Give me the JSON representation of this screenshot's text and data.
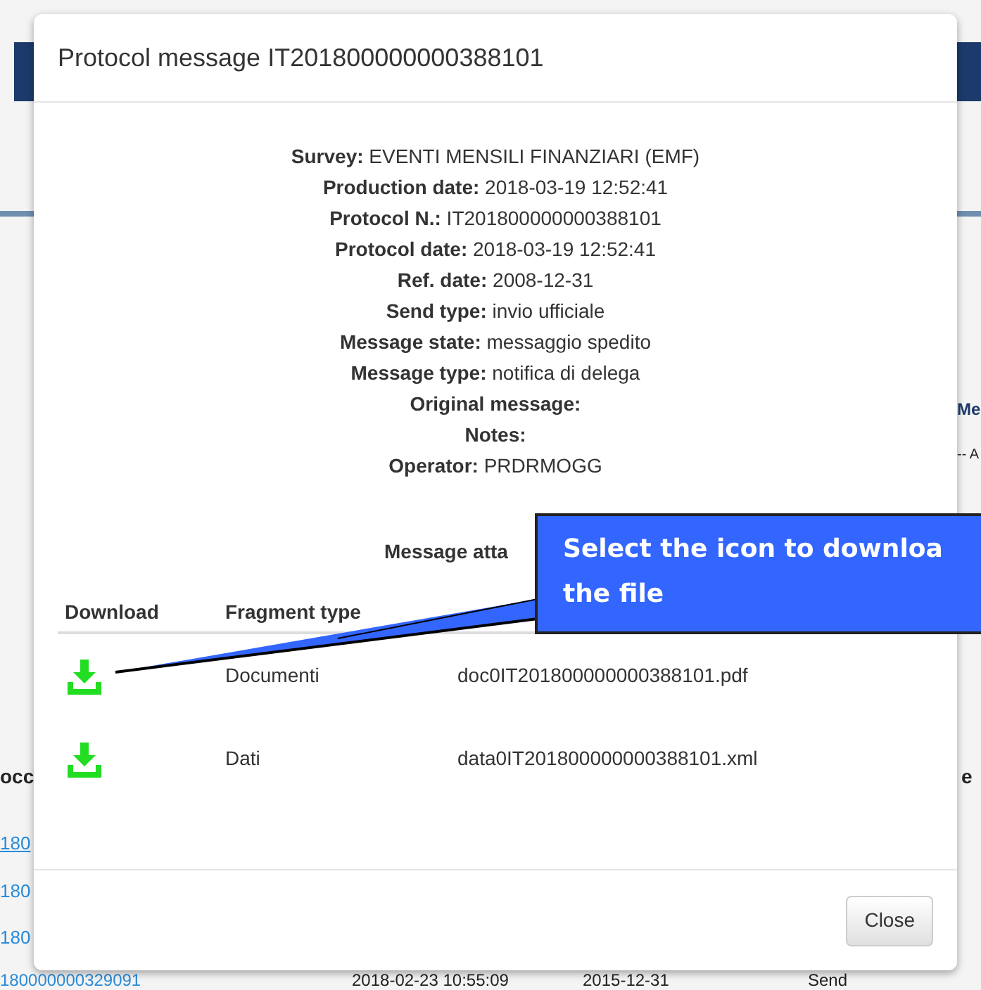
{
  "background": {
    "header_fragments": [
      "occ",
      "e"
    ],
    "right_fragments": [
      "Me",
      "-- A"
    ],
    "link_fragments": [
      "180",
      "180",
      "180"
    ],
    "last_row": [
      "180000000329091",
      "2018-02-23 10:55:09",
      "2015-12-31",
      "Send"
    ]
  },
  "modal": {
    "title": "Protocol message IT201800000000388101",
    "details": [
      {
        "label": "Survey:",
        "value": "EVENTI MENSILI FINANZIARI (EMF)"
      },
      {
        "label": "Production date:",
        "value": "2018-03-19 12:52:41"
      },
      {
        "label": "Protocol N.:",
        "value": "IT201800000000388101"
      },
      {
        "label": "Protocol date:",
        "value": "2018-03-19 12:52:41"
      },
      {
        "label": "Ref. date:",
        "value": "2008-12-31"
      },
      {
        "label": "Send type:",
        "value": "invio ufficiale"
      },
      {
        "label": "Message state:",
        "value": "messaggio spedito"
      },
      {
        "label": "Message type:",
        "value": "notifica di delega"
      },
      {
        "label": "Original message:"
      },
      {
        "label": "Notes:"
      },
      {
        "label": "Operator:",
        "value": "PRDRMOGG"
      }
    ],
    "attachments_heading": "Message atta",
    "columns": [
      "Download",
      "Fragment type"
    ],
    "rows": [
      {
        "fragment_type": "Documenti",
        "file": "doc0IT201800000000388101.pdf"
      },
      {
        "fragment_type": "Dati",
        "file": "data0IT201800000000388101.xml"
      }
    ],
    "close_button": "Close"
  },
  "callout": {
    "lines": [
      "Select the icon to downloa",
      "the file"
    ]
  }
}
